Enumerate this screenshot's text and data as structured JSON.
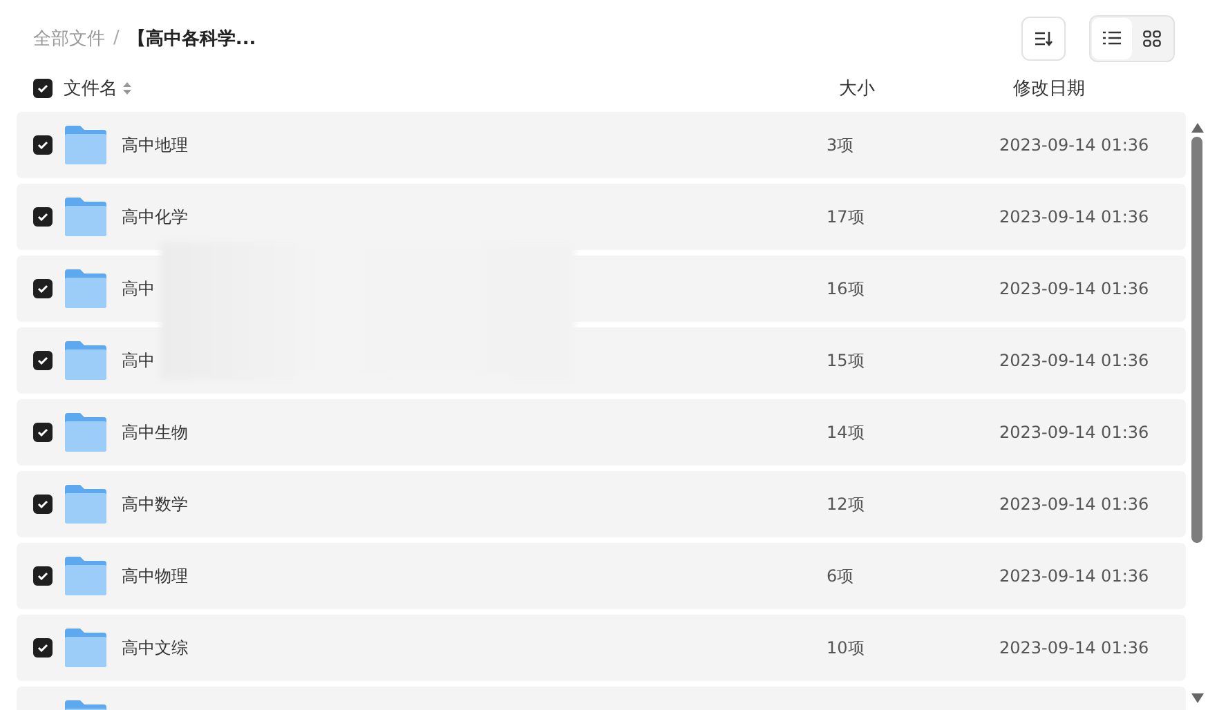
{
  "breadcrumb_separator": "/",
  "breadcrumb": [
    {
      "label": "全部文件",
      "current": false
    },
    {
      "label": "【高中各科学...",
      "current": true
    }
  ],
  "view_modes": [
    {
      "kind": "list",
      "selected": true
    },
    {
      "kind": "grid",
      "selected": false
    }
  ],
  "table": {
    "select_all_checked": true,
    "columns": [
      "文件名",
      "大小",
      "修改日期"
    ],
    "rows": [
      {
        "name": "高中地理",
        "size": "3项",
        "date": "2023-09-14 01:36",
        "checked": true
      },
      {
        "name": "高中化学",
        "size": "17项",
        "date": "2023-09-14 01:36",
        "checked": true
      },
      {
        "name": "高中",
        "size": "16项",
        "date": "2023-09-14 01:36",
        "checked": true
      },
      {
        "name": "高中",
        "size": "15项",
        "date": "2023-09-14 01:36",
        "checked": true
      },
      {
        "name": "高中生物",
        "size": "14项",
        "date": "2023-09-14 01:36",
        "checked": true
      },
      {
        "name": "高中数学",
        "size": "12项",
        "date": "2023-09-14 01:36",
        "checked": true
      },
      {
        "name": "高中物理",
        "size": "6项",
        "date": "2023-09-14 01:36",
        "checked": true
      },
      {
        "name": "高中文综",
        "size": "10项",
        "date": "2023-09-14 01:36",
        "checked": true
      }
    ]
  }
}
